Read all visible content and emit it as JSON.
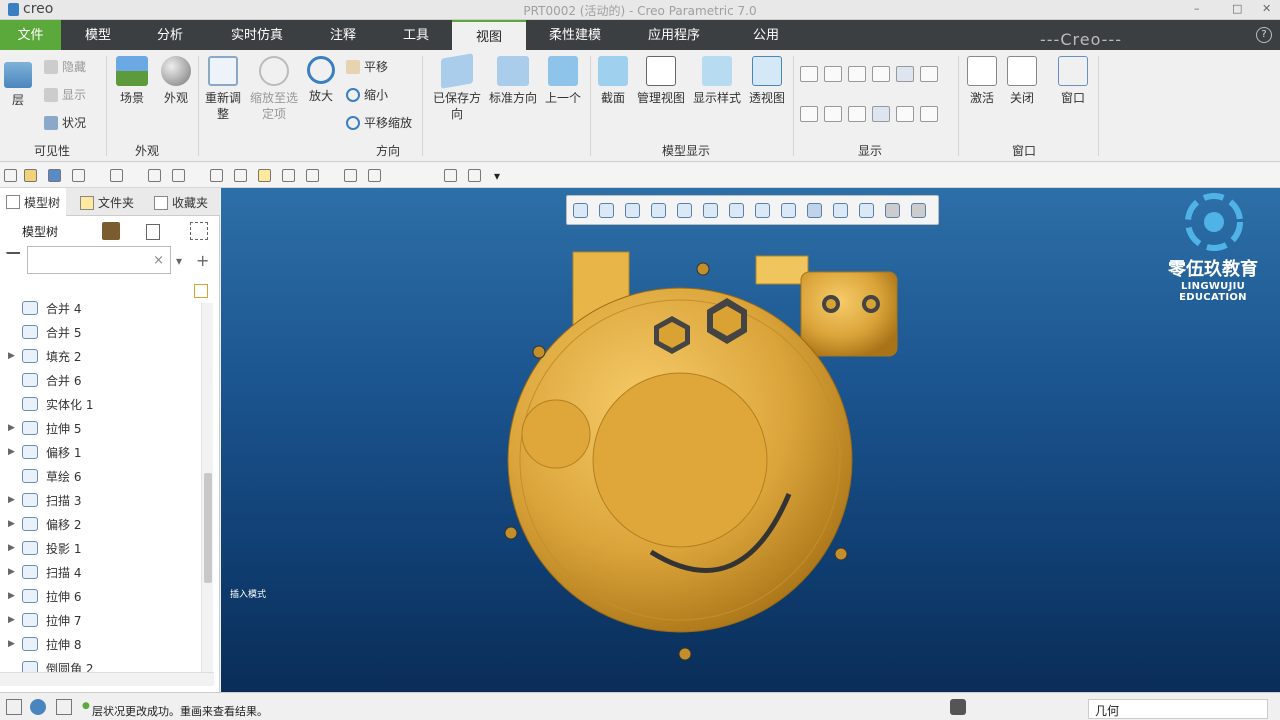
{
  "app": {
    "logo_text": "creo",
    "window_title": "PRT0002 (活动的) - Creo Parametric 7.0",
    "controls": [
      "–",
      "□",
      "✕"
    ]
  },
  "menu": {
    "file": "文件",
    "tabs": [
      "模型",
      "分析",
      "实时仿真",
      "注释",
      "工具",
      "视图",
      "柔性建模",
      "应用程序",
      "公用"
    ],
    "active_index": 5,
    "help": "?",
    "watermark": "---Creo---"
  },
  "ribbon": {
    "visibility": {
      "layer": "层",
      "hide": "隐藏",
      "show": "显示",
      "status": "状况",
      "group": "可见性"
    },
    "appearance": {
      "scene": "场景",
      "look": "外观",
      "group": "外观"
    },
    "orientation": {
      "refit": "重新调整",
      "zoom_sel": "缩放至选定项",
      "zoom_in": "放大",
      "pan": "平移",
      "zoom_out": "缩小",
      "pan_zoom": "平移缩放",
      "group": "方向"
    },
    "saved": {
      "saved_orient": "已保存方向",
      "std_orient": "标准方向",
      "prev": "上一个"
    },
    "model_display": {
      "section": "截面",
      "manage_views": "管理视图",
      "display_style": "显示样式",
      "perspective": "透视图",
      "group": "模型显示"
    },
    "show": {
      "group": "显示"
    },
    "window": {
      "activate": "激活",
      "close": "关闭",
      "window": "窗口",
      "group": "窗口"
    }
  },
  "panel": {
    "tabs": [
      "模型树",
      "文件夹",
      "收藏夹"
    ],
    "tree_header": "模型树",
    "filter_placeholder": "",
    "items": [
      {
        "label": "合并 4",
        "expand": false
      },
      {
        "label": "合并 5",
        "expand": false
      },
      {
        "label": "填充 2",
        "expand": true
      },
      {
        "label": "合并 6",
        "expand": false
      },
      {
        "label": "实体化 1",
        "expand": false
      },
      {
        "label": "拉伸 5",
        "expand": true
      },
      {
        "label": "偏移 1",
        "expand": true
      },
      {
        "label": "草绘 6",
        "expand": false
      },
      {
        "label": "扫描 3",
        "expand": true
      },
      {
        "label": "偏移 2",
        "expand": true
      },
      {
        "label": "投影 1",
        "expand": true
      },
      {
        "label": "扫描 4",
        "expand": true
      },
      {
        "label": "拉伸 6",
        "expand": true
      },
      {
        "label": "拉伸 7",
        "expand": true
      },
      {
        "label": "拉伸 8",
        "expand": true
      },
      {
        "label": "倒圆角 2",
        "expand": false
      }
    ]
  },
  "viewport": {
    "brand_cn": "零伍玖教育",
    "brand_en": "LINGWUJIU EDUCATION",
    "mode_text": "插入模式"
  },
  "status": {
    "message": "层状况更改成功。重画来查看结果。",
    "selector": "几何"
  },
  "colors": {
    "accent": "#5ba93b",
    "part": "#d9a233",
    "viewport_top": "#2d6fa8",
    "viewport_bottom": "#0a2d57"
  }
}
